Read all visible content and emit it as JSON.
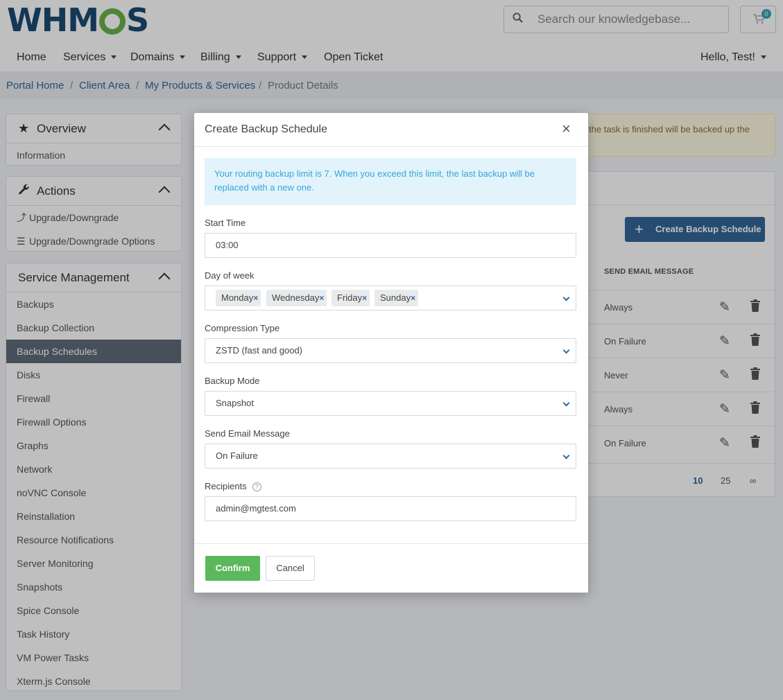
{
  "brand": {
    "logo_left": "WHM",
    "logo_right": "S"
  },
  "search": {
    "placeholder": "Search our knowledgebase..."
  },
  "cart": {
    "count": "0"
  },
  "nav": {
    "home": "Home",
    "services": "Services",
    "domains": "Domains",
    "billing": "Billing",
    "support": "Support",
    "open_ticket": "Open Ticket",
    "user": "Hello, Test!"
  },
  "breadcrumb": {
    "items": [
      "Portal Home",
      "Client Area",
      "My Products & Services",
      "Product Details"
    ],
    "separator": "/"
  },
  "sidebar": {
    "overview": {
      "title": "Overview",
      "items": [
        "Information"
      ]
    },
    "actions": {
      "title": "Actions",
      "items": [
        "Upgrade/Downgrade",
        "Upgrade/Downgrade Options"
      ]
    },
    "service_management": {
      "title": "Service Management",
      "items": [
        "Backups",
        "Backup Collection",
        "Backup Schedules",
        "Disks",
        "Firewall",
        "Firewall Options",
        "Graphs",
        "Network",
        "noVNC Console",
        "Reinstallation",
        "Resource Notifications",
        "Server Monitoring",
        "Snapshots",
        "Spice Console",
        "Task History",
        "VM Power Tasks",
        "Xterm.js Console"
      ],
      "active": "Backup Schedules"
    }
  },
  "background": {
    "alert_text": "the task is finished will be backed up the",
    "create_button": "Create Backup Schedule",
    "column_header": "SEND EMAIL MESSAGE",
    "rows": [
      "Always",
      "On Failure",
      "Never",
      "Always",
      "On Failure"
    ],
    "pagination": [
      "10",
      "25",
      "∞"
    ]
  },
  "modal": {
    "title": "Create Backup Schedule",
    "info": "Your routing backup limit is 7. When you exceed this limit, the last backup will be replaced with a new one.",
    "start_time": {
      "label": "Start Time",
      "value": "03:00"
    },
    "day_of_week": {
      "label": "Day of week",
      "selected": [
        "Monday",
        "Wednesday",
        "Friday",
        "Sunday"
      ]
    },
    "compression_type": {
      "label": "Compression Type",
      "value": "ZSTD (fast and good)"
    },
    "backup_mode": {
      "label": "Backup Mode",
      "value": "Snapshot"
    },
    "send_email": {
      "label": "Send Email Message",
      "value": "On Failure"
    },
    "recipients": {
      "label": "Recipients",
      "value": "admin@mgtest.com"
    },
    "confirm": "Confirm",
    "cancel": "Cancel"
  },
  "colors": {
    "brand_blue": "#336699",
    "success_green": "#5cb85c",
    "info_text": "#36a5d8",
    "info_bg": "#e2f3fc",
    "sidebar_active": "#5f6a78"
  },
  "icons": [
    "search-icon",
    "cart-icon",
    "star-icon",
    "wrench-icon",
    "arrow-up-icon",
    "list-icon",
    "close-icon",
    "chevron-down-icon",
    "help-icon",
    "plus-icon",
    "edit-icon",
    "trash-icon"
  ]
}
